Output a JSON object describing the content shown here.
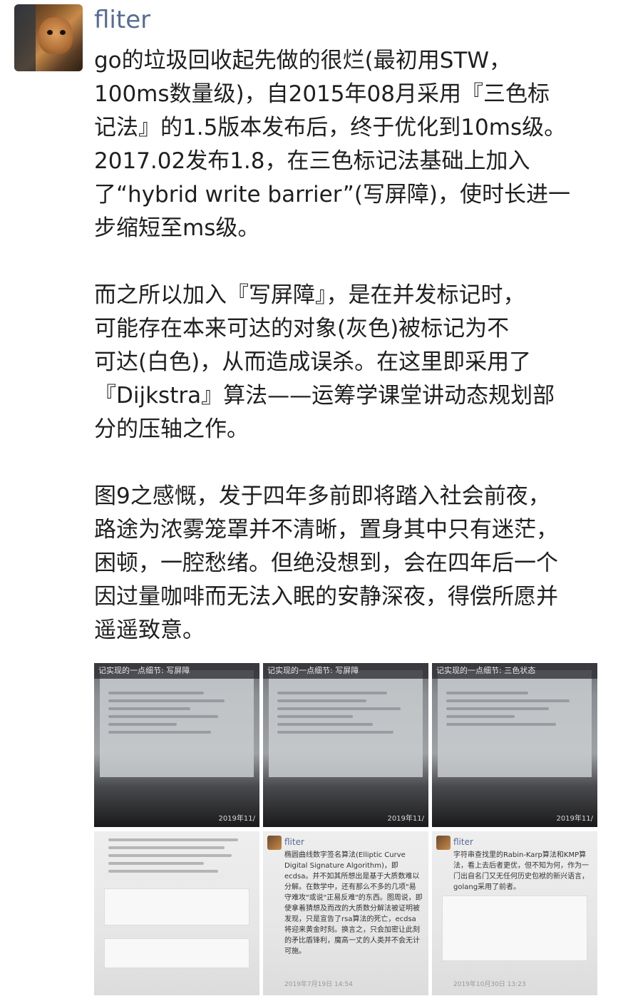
{
  "author": {
    "name": "fliter",
    "avatar_icon": "cat-avatar-icon"
  },
  "post": {
    "paragraphs": [
      "go的垃圾回收起先做的很烂(最初用STW，\n100ms数量级)，自2015年08月采用『三色标\n记法』的1.5版本发布后，终于优化到10ms级。\n2017.02发布1.8，在三色标记法基础上加入\n了“hybrid write barrier”(写屏障)，使时长进一\n步缩短至ms级。",
      "而之所以加入『写屏障』，是在并发标记时，\n可能存在本来可达的对象(灰色)被标记为不\n可达(白色)，从而造成误杀。在这里即采用了\n『Dijkstra』算法——运筹学课堂讲动态规划部\n分的压轴之作。",
      "图9之感慨，发于四年多前即将踏入社会前夜，\n路途为浓雾笼罩并不清晰，置身其中只有迷茫，\n困顿，一腔愁绪。但绝没想到，会在四年后一个\n因过量咖啡而无法入眠的安静深夜，得偿所愿并\n遥遥致意。"
    ]
  },
  "photos": [
    {
      "caption": "记实现的一点细节: 写屏障",
      "date": "2019年11/"
    },
    {
      "caption": "记实现的一点细节: 写屏障",
      "date": "2019年11/"
    },
    {
      "caption": "记实现的一点细节: 三色状态",
      "date": "2019年11/"
    },
    {
      "caption": "",
      "date": ""
    },
    {
      "name": "fliter",
      "text": "椭圆曲线数字签名算法(Elliptic Curve Digital Signature Algorithm)，即ecdsa。并不如其所想出是基于大质数难以分解。在数学中，还有那么不多的几项\"易守难攻\"或说\"正易反难\"的东西。图周说，即使拿着猜想及而改的大质数分解法被证明被发现，只是宣告了rsa算法的死亡，ecdsa将迎来黄金时刻。换言之，只会加密让此刻的矛比盾锋利，魔高一丈的人类并不会无计可施。",
      "date": "2019年7月19日 14:54"
    },
    {
      "name": "fliter",
      "text": "字符串查找里的Rabin-Karp算法和KMP算法，看上去后者更优，但不知为何，作为一门出自名门又无任何历史包袱的新兴语言，golang采用了前者。",
      "date": "2019年10月30日 13:23"
    }
  ]
}
